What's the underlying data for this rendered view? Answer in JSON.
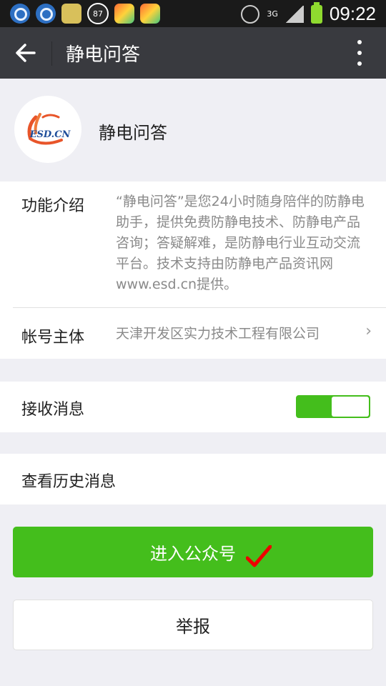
{
  "status_bar": {
    "notification_badge": "87",
    "network": "3G",
    "time": "09:22",
    "icons": [
      "qq-icon",
      "qq-icon",
      "mail-icon",
      "badge-87-icon",
      "app-icon",
      "app-icon",
      "alarm-icon",
      "signal-icon",
      "battery-icon"
    ]
  },
  "title_bar": {
    "title": "静电问答",
    "back_icon": "arrow-left-icon",
    "more_icon": "more-vertical-icon"
  },
  "profile": {
    "name": "静电问答",
    "logo_text": "ESD.CN"
  },
  "info": {
    "intro_label": "功能介绍",
    "intro_text": "“静电问答”是您24小时随身陪伴的防静电助手，提供免费防静电技术、防静电产品咨询；答疑解难，是防静电行业互动交流平台。技术支持由防静电产品资讯网www.esd.cn提供。",
    "account_label": "帐号主体",
    "account_value": "天津开发区实力技术工程有限公司"
  },
  "settings": {
    "receive_label": "接收消息",
    "receive_enabled": true,
    "history_label": "查看历史消息"
  },
  "actions": {
    "enter_label": "进入公众号",
    "report_label": "举报"
  },
  "colors": {
    "accent_green": "#44be1c",
    "title_bar": "#393a3f",
    "background": "#efeff4",
    "logo_orange": "#e8552a",
    "logo_blue": "#1f4e9a"
  }
}
